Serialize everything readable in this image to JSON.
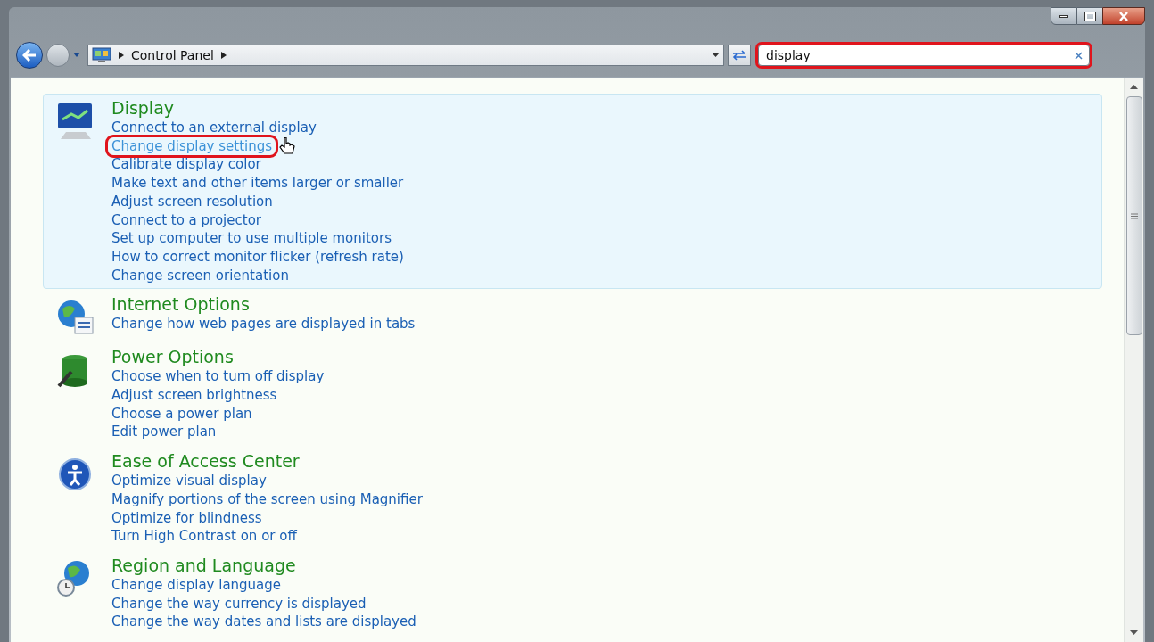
{
  "address_bar": {
    "breadcrumb": [
      "Control Panel"
    ]
  },
  "search": {
    "value": "display",
    "highlighted": true
  },
  "results": [
    {
      "title": "Display",
      "kind": "display",
      "selected": true,
      "links": [
        {
          "text": "Connect to an external display",
          "hovered": false,
          "highlighted": false
        },
        {
          "text": "Change display settings",
          "hovered": true,
          "highlighted": true
        },
        {
          "text": "Calibrate display color",
          "hovered": false,
          "highlighted": false
        },
        {
          "text": "Make text and other items larger or smaller",
          "hovered": false,
          "highlighted": false
        },
        {
          "text": "Adjust screen resolution",
          "hovered": false,
          "highlighted": false
        },
        {
          "text": "Connect to a projector",
          "hovered": false,
          "highlighted": false
        },
        {
          "text": "Set up computer to use multiple monitors",
          "hovered": false,
          "highlighted": false
        },
        {
          "text": "How to correct monitor flicker (refresh rate)",
          "hovered": false,
          "highlighted": false
        },
        {
          "text": "Change screen orientation",
          "hovered": false,
          "highlighted": false
        }
      ]
    },
    {
      "title": "Internet Options",
      "kind": "internet",
      "selected": false,
      "links": [
        {
          "text": "Change how web pages are displayed in tabs",
          "hovered": false,
          "highlighted": false
        }
      ]
    },
    {
      "title": "Power Options",
      "kind": "power",
      "selected": false,
      "links": [
        {
          "text": "Choose when to turn off display",
          "hovered": false,
          "highlighted": false
        },
        {
          "text": "Adjust screen brightness",
          "hovered": false,
          "highlighted": false
        },
        {
          "text": "Choose a power plan",
          "hovered": false,
          "highlighted": false
        },
        {
          "text": "Edit power plan",
          "hovered": false,
          "highlighted": false
        }
      ]
    },
    {
      "title": "Ease of Access Center",
      "kind": "access",
      "selected": false,
      "links": [
        {
          "text": "Optimize visual display",
          "hovered": false,
          "highlighted": false
        },
        {
          "text": "Magnify portions of the screen using Magnifier",
          "hovered": false,
          "highlighted": false
        },
        {
          "text": "Optimize for blindness",
          "hovered": false,
          "highlighted": false
        },
        {
          "text": "Turn High Contrast on or off",
          "hovered": false,
          "highlighted": false
        }
      ]
    },
    {
      "title": "Region and Language",
      "kind": "region",
      "selected": false,
      "links": [
        {
          "text": "Change display language",
          "hovered": false,
          "highlighted": false
        },
        {
          "text": "Change the way currency is displayed",
          "hovered": false,
          "highlighted": false
        },
        {
          "text": "Change the way dates and lists are displayed",
          "hovered": false,
          "highlighted": false
        }
      ]
    }
  ]
}
